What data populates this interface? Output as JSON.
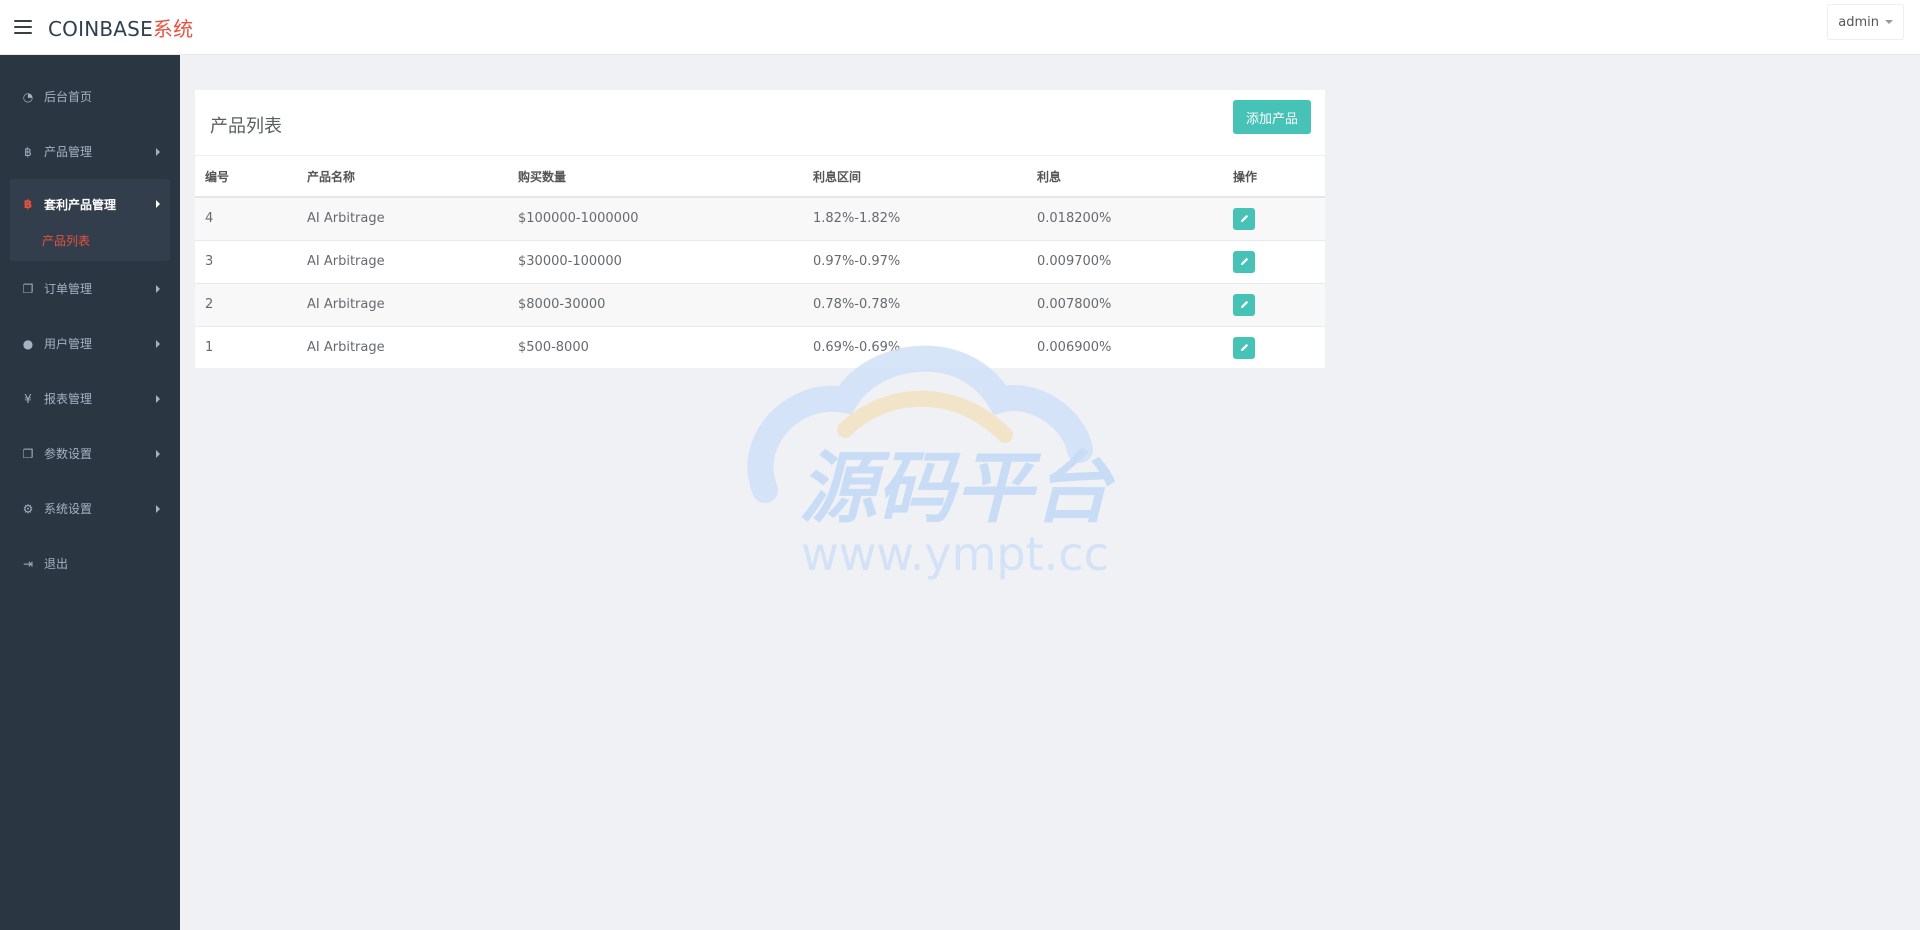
{
  "header": {
    "brand_main": "COINBASE",
    "brand_accent": "系统",
    "user": "admin"
  },
  "sidebar": {
    "items": [
      {
        "icon": "dashboard-icon",
        "glyph": "◔",
        "label": "后台首页"
      },
      {
        "icon": "bitcoin-icon",
        "glyph": "฿",
        "label": "产品管理"
      },
      {
        "icon": "bitcoin-icon",
        "glyph": "฿",
        "label": "套利产品管理",
        "active": true,
        "sub": [
          {
            "label": "产品列表"
          }
        ]
      },
      {
        "icon": "copy-icon",
        "glyph": "❐",
        "label": "订单管理"
      },
      {
        "icon": "user-icon",
        "glyph": "●",
        "label": "用户管理"
      },
      {
        "icon": "yen-icon",
        "glyph": "¥",
        "label": "报表管理"
      },
      {
        "icon": "copy-icon",
        "glyph": "❐",
        "label": "参数设置"
      },
      {
        "icon": "cogs-icon",
        "glyph": "⚙",
        "label": "系统设置"
      },
      {
        "icon": "sign-out-icon",
        "glyph": "⇥",
        "label": "退出"
      }
    ]
  },
  "panel": {
    "title": "产品列表",
    "add_label": "添加产品",
    "columns": [
      "编号",
      "产品名称",
      "购买数量",
      "利息区间",
      "利息",
      "操作"
    ],
    "rows": [
      {
        "id": "4",
        "name": "AI Arbitrage",
        "amount": "$100000-1000000",
        "range": "1.82%-1.82%",
        "rate": "0.018200%"
      },
      {
        "id": "3",
        "name": "AI Arbitrage",
        "amount": "$30000-100000",
        "range": "0.97%-0.97%",
        "rate": "0.009700%"
      },
      {
        "id": "2",
        "name": "AI Arbitrage",
        "amount": "$8000-30000",
        "range": "0.78%-0.78%",
        "rate": "0.007800%"
      },
      {
        "id": "1",
        "name": "AI Arbitrage",
        "amount": "$500-8000",
        "range": "0.69%-0.69%",
        "rate": "0.006900%"
      }
    ]
  },
  "watermark": {
    "title": "源码平台",
    "url": "www.ympt.cc"
  },
  "colors": {
    "accent": "#e8523f",
    "teal": "#47c2b6",
    "sidebar_bg": "#2b3643"
  }
}
